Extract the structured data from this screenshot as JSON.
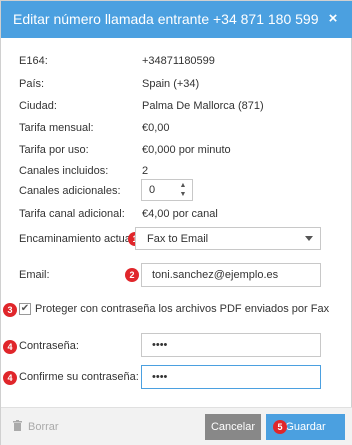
{
  "dialog": {
    "title": "Editar número llamada entrante +34 871 180 599",
    "close_icon": "×"
  },
  "fields": {
    "e164_label": "E164:",
    "e164_value": "+34871180599",
    "pais_label": "País:",
    "pais_value": "Spain (+34)",
    "ciudad_label": "Ciudad:",
    "ciudad_value": "Palma De Mallorca (871)",
    "tarifa_mensual_label": "Tarifa mensual:",
    "tarifa_mensual_value": "€0,00",
    "tarifa_uso_label": "Tarifa por uso:",
    "tarifa_uso_value": "€0,000 por minuto",
    "canales_incluidos_label": "Canales incluidos:",
    "canales_incluidos_value": "2",
    "canales_adicionales_label": "Canales adicionales:",
    "canales_adicionales_value": "0",
    "tarifa_canal_label": "Tarifa canal adicional:",
    "tarifa_canal_value": "€4,00 por canal",
    "encaminamiento_label": "Encaminamiento actual:",
    "encaminamiento_value": "Fax to Email",
    "email_label": "Email:",
    "email_value": "toni.sanchez@ejemplo.es",
    "proteger_label": "Proteger con contraseña los archivos PDF enviados por Fax",
    "proteger_checked": true,
    "password_label": "Contraseña:",
    "password_value": "••••",
    "confirm_label": "Confirme su contraseña:",
    "confirm_value": "••••"
  },
  "badges": {
    "b1": "1",
    "b2": "2",
    "b3": "3",
    "b4a": "4",
    "b4b": "4",
    "b5": "5"
  },
  "footer": {
    "delete_label": "Borrar",
    "cancel_label": "Cancelar",
    "save_label": "Guardar"
  },
  "colors": {
    "titlebar": "#4ba0e0",
    "badge": "#e0262b",
    "cancel_button": "#888888",
    "save_button": "#4ba0e0"
  },
  "icons": {
    "close": "close-icon",
    "up": "chevron-up-icon",
    "down": "chevron-down-icon",
    "caret": "caret-down-icon",
    "check": "checkmark-icon",
    "trash": "trash-icon"
  }
}
